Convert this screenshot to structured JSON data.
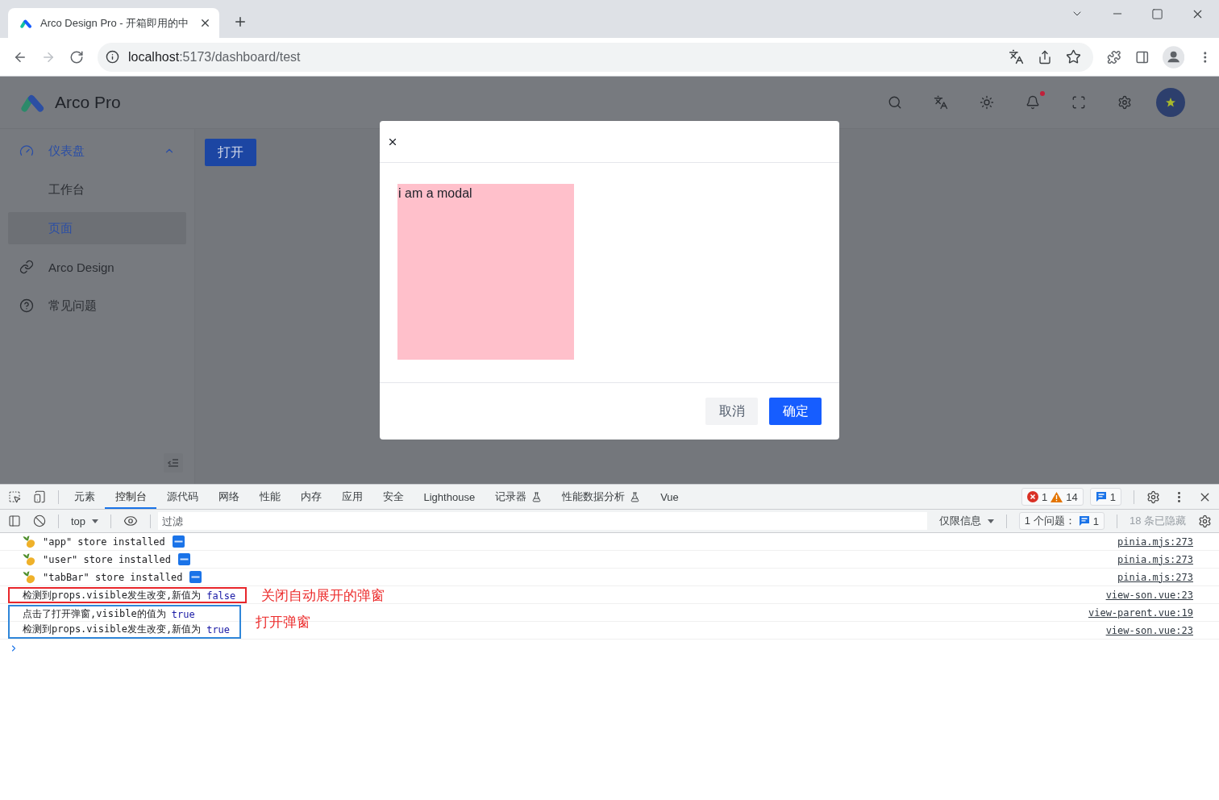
{
  "browser": {
    "tabs": [
      {
        "title": "Arco Design Pro - 开箱即用的中",
        "selected": true
      }
    ],
    "forward_disabled": true,
    "url": {
      "host": "localhost",
      "path": ":5173/dashboard/test"
    }
  },
  "app": {
    "header": {
      "title": "Arco Pro",
      "bell_badge": true
    },
    "sidebar": {
      "items": [
        {
          "label": "仪表盘",
          "expanded": true,
          "children": [
            {
              "label": "工作台",
              "selected": false
            },
            {
              "label": "页面",
              "selected": true
            }
          ]
        },
        {
          "label": "Arco Design",
          "selected": false
        },
        {
          "label": "常见问题",
          "selected": false
        }
      ]
    },
    "content": {
      "open_button": "打开"
    }
  },
  "modal": {
    "content": "i am a modal",
    "buttons": [
      {
        "label": "取消",
        "kind": "secondary"
      },
      {
        "label": "确定",
        "kind": "primary"
      }
    ]
  },
  "devtools": {
    "tabs": [
      {
        "label": "元素",
        "selected": false,
        "experimental": false
      },
      {
        "label": "控制台",
        "selected": true,
        "experimental": false
      },
      {
        "label": "源代码",
        "selected": false,
        "experimental": false
      },
      {
        "label": "网络",
        "selected": false,
        "experimental": false
      },
      {
        "label": "性能",
        "selected": false,
        "experimental": false
      },
      {
        "label": "内存",
        "selected": false,
        "experimental": false
      },
      {
        "label": "应用",
        "selected": false,
        "experimental": false
      },
      {
        "label": "安全",
        "selected": false,
        "experimental": false
      },
      {
        "label": "Lighthouse",
        "selected": false,
        "experimental": false
      },
      {
        "label": "记录器",
        "selected": false,
        "experimental": true
      },
      {
        "label": "性能数据分析",
        "selected": false,
        "experimental": true
      },
      {
        "label": "Vue",
        "selected": false,
        "experimental": false
      }
    ],
    "counters": {
      "errors": "1",
      "warnings": "14",
      "messages": "1"
    },
    "filter_bar": {
      "context": "top",
      "filter_placeholder": "过滤",
      "levels": "仅限信息",
      "issues_label": "1 个问题：",
      "issues_count": "1",
      "hidden": "18 条已隐藏"
    },
    "console": {
      "entries": [
        {
          "kind": "pinia",
          "text": "\"app\" store installed",
          "source": "pinia.mjs:273"
        },
        {
          "kind": "pinia",
          "text": "\"user\" store installed",
          "source": "pinia.mjs:273"
        },
        {
          "kind": "pinia",
          "text": "\"tabBar\" store installed",
          "source": "pinia.mjs:273"
        },
        {
          "kind": "annotation",
          "note": "关闭自动展开的弹窗",
          "color": "#e8262b",
          "messages": [
            {
              "text": "检测到props.visible发生改变,新值为",
              "value": "false",
              "source": "view-son.vue:23"
            }
          ]
        },
        {
          "kind": "annotation",
          "note": "打开弹窗",
          "color": "#2f86d9",
          "messages": [
            {
              "text": "点击了打开弹窗,visible的值为",
              "value": "true",
              "source": "view-parent.vue:19"
            },
            {
              "text": "检测到props.visible发生改变,新值为",
              "value": "true",
              "source": "view-son.vue:23"
            }
          ]
        }
      ]
    }
  }
}
